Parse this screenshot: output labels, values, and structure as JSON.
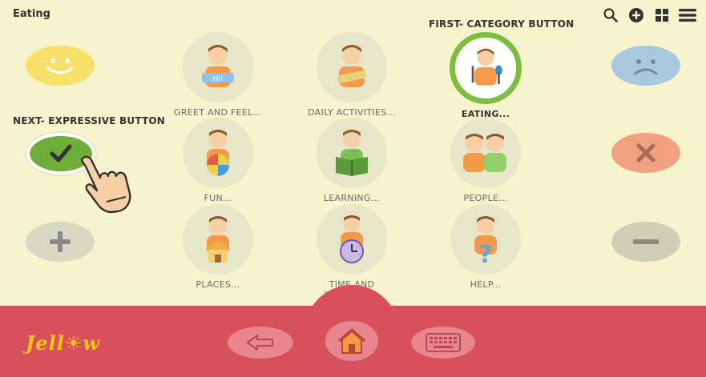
{
  "header": {
    "title": "Eating"
  },
  "annotations": {
    "first_category": "FIRST- CATEGORY BUTTON",
    "next_expressive": "NEXT- EXPRESSIVE BUTTON"
  },
  "categories": [
    {
      "label": "GREET AND FEEL...",
      "icon": "greet-icon"
    },
    {
      "label": "DAILY ACTIVITIES...",
      "icon": "daily-activities-icon"
    },
    {
      "label": "EATING...",
      "icon": "eating-icon",
      "selected": true
    },
    {
      "label": "FUN...",
      "icon": "fun-icon"
    },
    {
      "label": "LEARNING...",
      "icon": "learning-icon"
    },
    {
      "label": "PEOPLE...",
      "icon": "people-icon"
    },
    {
      "label": "PLACES...",
      "icon": "places-icon"
    },
    {
      "label": "TIME AND WEATHER...",
      "icon": "time-weather-icon"
    },
    {
      "label": "HELP...",
      "icon": "help-icon"
    }
  ],
  "logo": {
    "text": "Jellow"
  },
  "colors": {
    "background": "#f6f3cd",
    "bottom_bar": "#d9505d",
    "selected_ring": "#7cbf3f",
    "like": "#f7e06a",
    "dislike": "#a8c8e0",
    "yes": "#6fae3a",
    "no": "#f0a280",
    "more": "#d8d8c4",
    "less": "#cfcfb8"
  }
}
